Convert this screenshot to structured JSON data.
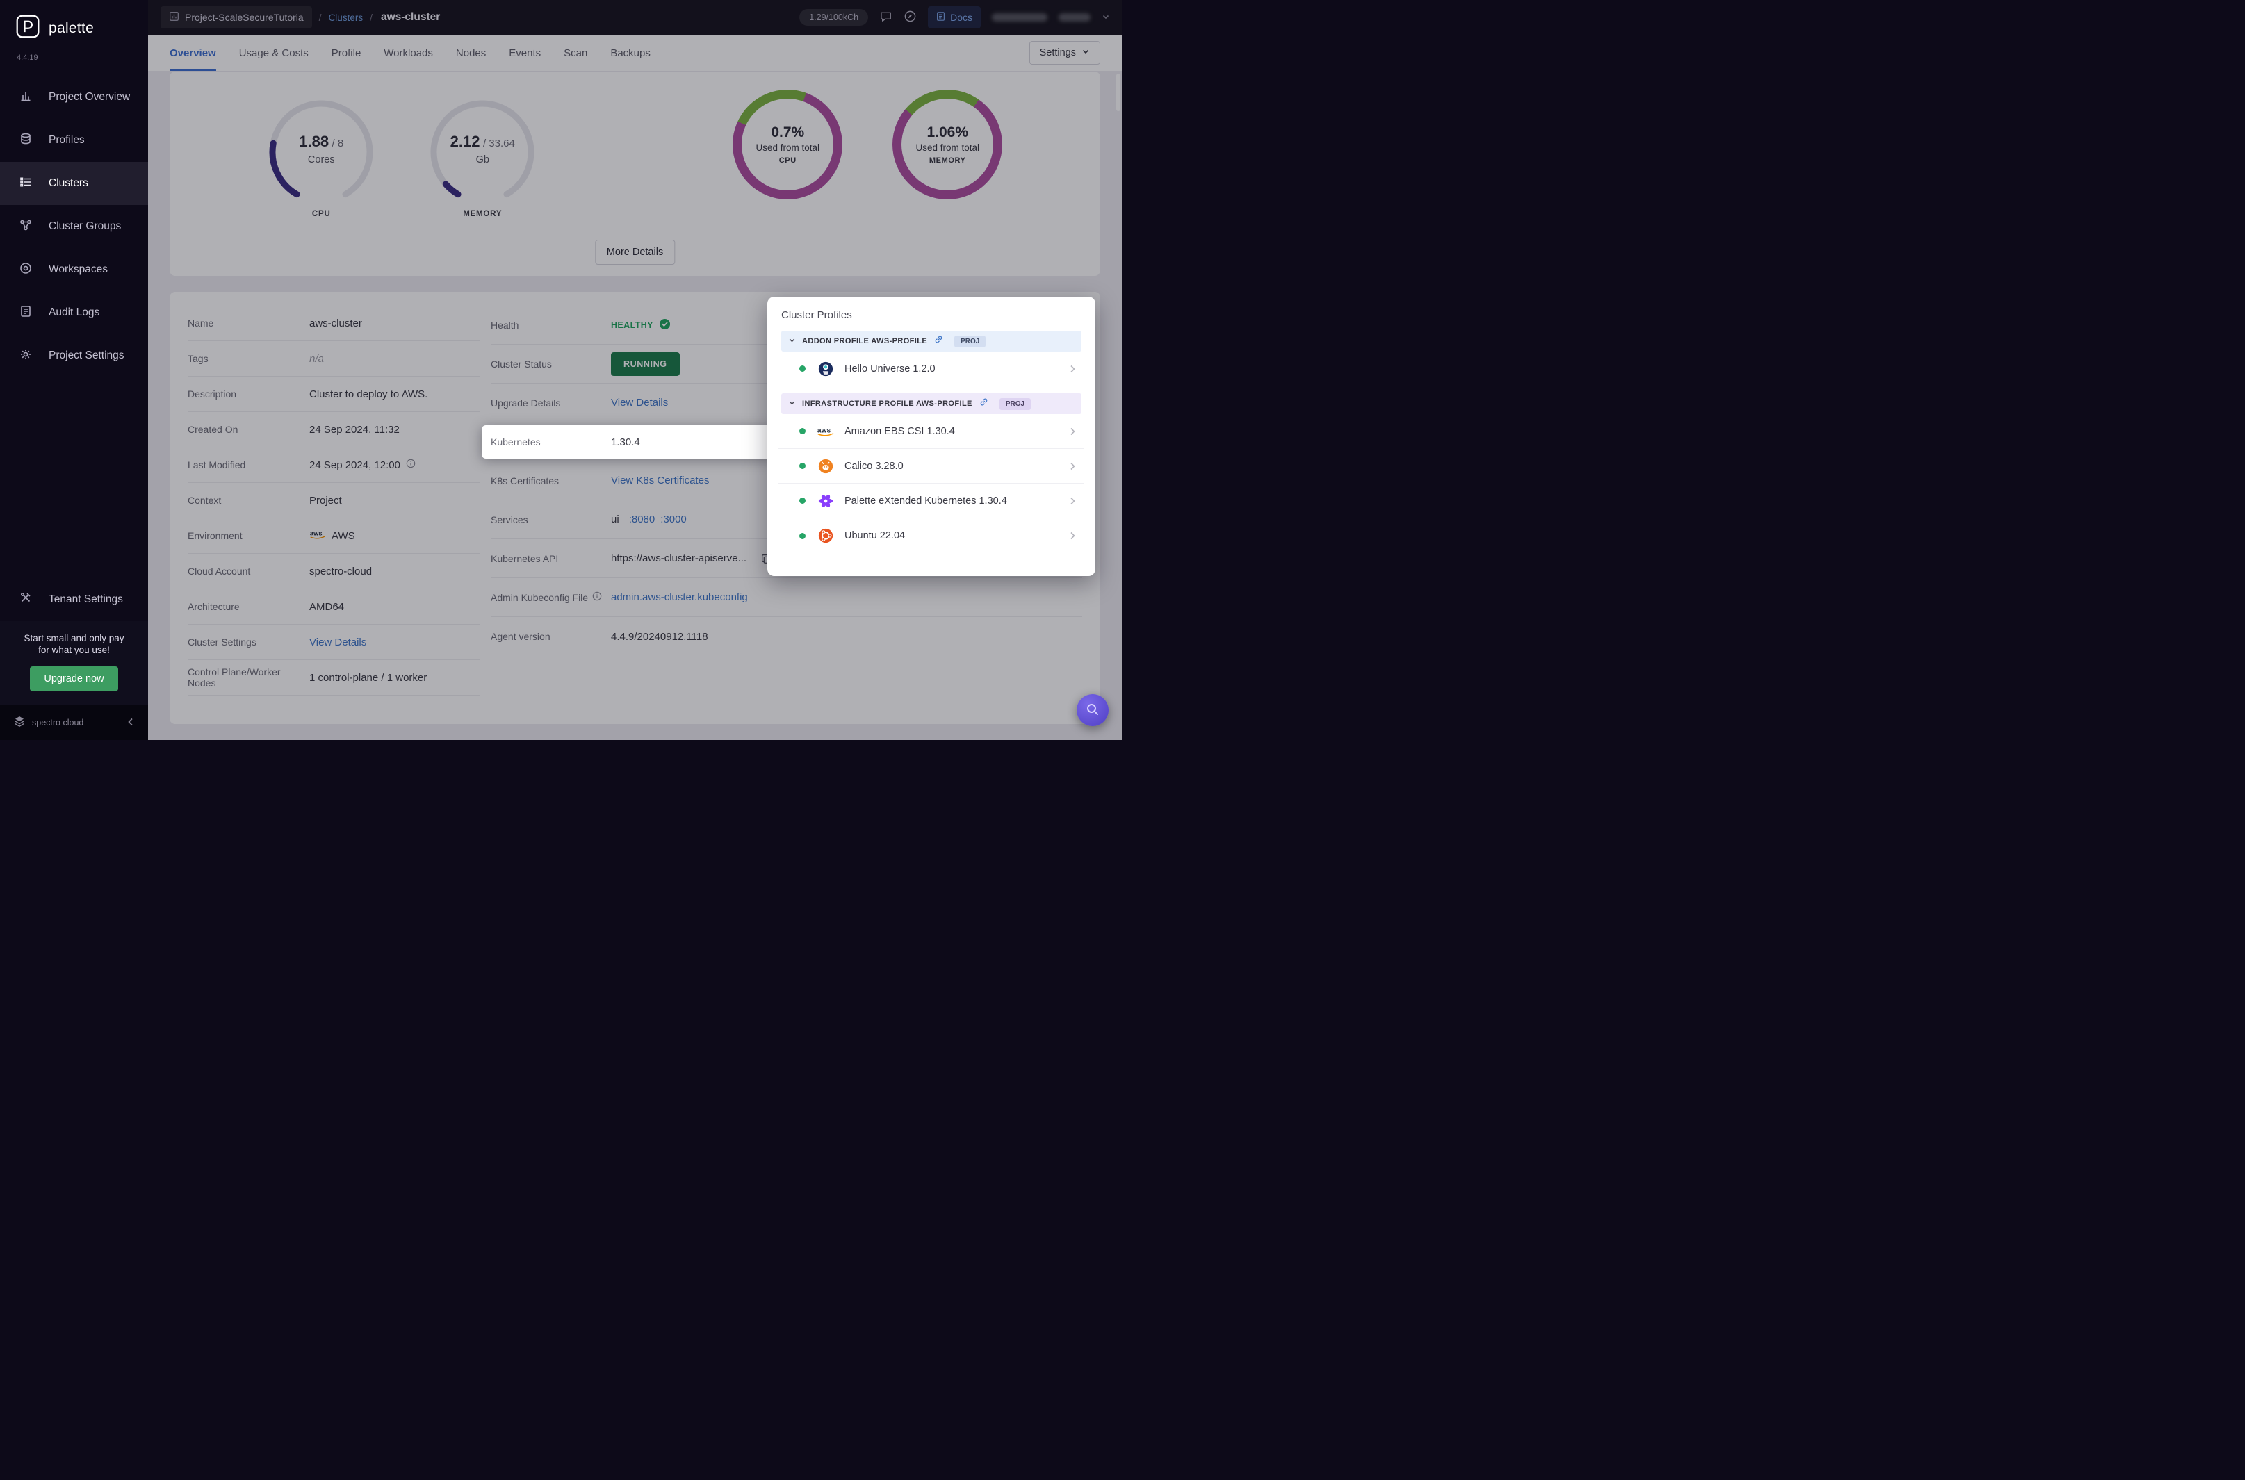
{
  "sidebar": {
    "logo_text": "palette",
    "version": "4.4.19",
    "items": [
      {
        "label": "Project Overview"
      },
      {
        "label": "Profiles"
      },
      {
        "label": "Clusters",
        "active": true
      },
      {
        "label": "Cluster Groups"
      },
      {
        "label": "Workspaces"
      },
      {
        "label": "Audit Logs"
      },
      {
        "label": "Project Settings"
      }
    ],
    "tenant_settings": "Tenant Settings",
    "promo_line1": "Start small and only pay",
    "promo_line2": "for what you use!",
    "upgrade_button": "Upgrade now",
    "brand": "spectro cloud"
  },
  "topbar": {
    "project_chip": "Project-ScaleSecureTutoria",
    "separator": "/",
    "clusters_link": "Clusters",
    "cluster_name": "aws-cluster",
    "usage_pill": "1.29/100kCh",
    "docs_label": "Docs"
  },
  "tabs": {
    "overview": "Overview",
    "usage_costs": "Usage & Costs",
    "profile": "Profile",
    "workloads": "Workloads",
    "nodes": "Nodes",
    "events": "Events",
    "scan": "Scan",
    "backups": "Backups",
    "settings_button": "Settings"
  },
  "metrics": {
    "cpu_gauge": {
      "value": "1.88",
      "total": "/ 8",
      "unit": "Cores",
      "label": "CPU",
      "used": 1.88,
      "capacity": 8
    },
    "memory_gauge": {
      "value": "2.12",
      "total": "/ 33.64",
      "unit": "Gb",
      "label": "MEMORY",
      "used": 2.12,
      "capacity": 33.64
    },
    "cpu_usage_donut": {
      "percent": "0.7%",
      "caption": "Used from total",
      "label": "CPU"
    },
    "memory_usage_donut": {
      "percent": "1.06%",
      "caption": "Used from total",
      "label": "MEMORY"
    },
    "more_details": "More Details"
  },
  "details": {
    "left": [
      {
        "label": "Name",
        "value": "aws-cluster"
      },
      {
        "label": "Tags",
        "value": "n/a"
      },
      {
        "label": "Description",
        "value": "Cluster to deploy to AWS."
      },
      {
        "label": "Created On",
        "value": "24 Sep 2024, 11:32"
      },
      {
        "label": "Last Modified",
        "value": "24 Sep 2024, 12:00"
      },
      {
        "label": "Context",
        "value": "Project"
      },
      {
        "label": "Environment",
        "value": "AWS"
      },
      {
        "label": "Cloud Account",
        "value": "spectro-cloud"
      },
      {
        "label": "Architecture",
        "value": "AMD64"
      },
      {
        "label": "Cluster Settings",
        "value": "View Details"
      },
      {
        "label": "Control Plane/Worker Nodes",
        "value": "1 control-plane / 1 worker"
      }
    ],
    "right": [
      {
        "label": "Health",
        "value": "HEALTHY"
      },
      {
        "label": "Cluster Status",
        "value": "RUNNING"
      },
      {
        "label": "Upgrade Details",
        "value": "View Details"
      },
      {
        "label": "Kubernetes",
        "value": "1.30.4"
      },
      {
        "label": "K8s Certificates",
        "value": "View K8s Certificates"
      },
      {
        "label": "Services",
        "prefix": "ui",
        "port1": ":8080",
        "port2": ":3000"
      },
      {
        "label": "Kubernetes API",
        "value": "https://aws-cluster-apiserve..."
      },
      {
        "label": "Admin Kubeconfig File",
        "value": "admin.aws-cluster.kubeconfig"
      },
      {
        "label": "Agent version",
        "value": "4.4.9/20240912.1118"
      }
    ]
  },
  "profiles_panel": {
    "title": "Cluster Profiles",
    "addon": {
      "header": "ADDON PROFILE AWS-PROFILE",
      "badge": "PROJ",
      "items": [
        {
          "name": "Hello Universe 1.2.0"
        }
      ]
    },
    "infrastructure": {
      "header": "INFRASTRUCTURE PROFILE AWS-PROFILE",
      "badge": "PROJ",
      "items": [
        {
          "name": "Amazon EBS CSI 1.30.4"
        },
        {
          "name": "Calico 3.28.0"
        },
        {
          "name": "Palette eXtended Kubernetes 1.30.4"
        },
        {
          "name": "Ubuntu 22.04"
        }
      ]
    }
  },
  "colors": {
    "accent_blue": "#4077c8",
    "tab_blue": "#3d6fd0",
    "healthy_green": "#21a65f",
    "running_green": "#1d7c4c",
    "gauge_indigo": "#3b2e84",
    "donut_magenta": "#ad4fa0",
    "donut_green": "#7cb342",
    "upgrade_green": "#3d9d61"
  }
}
